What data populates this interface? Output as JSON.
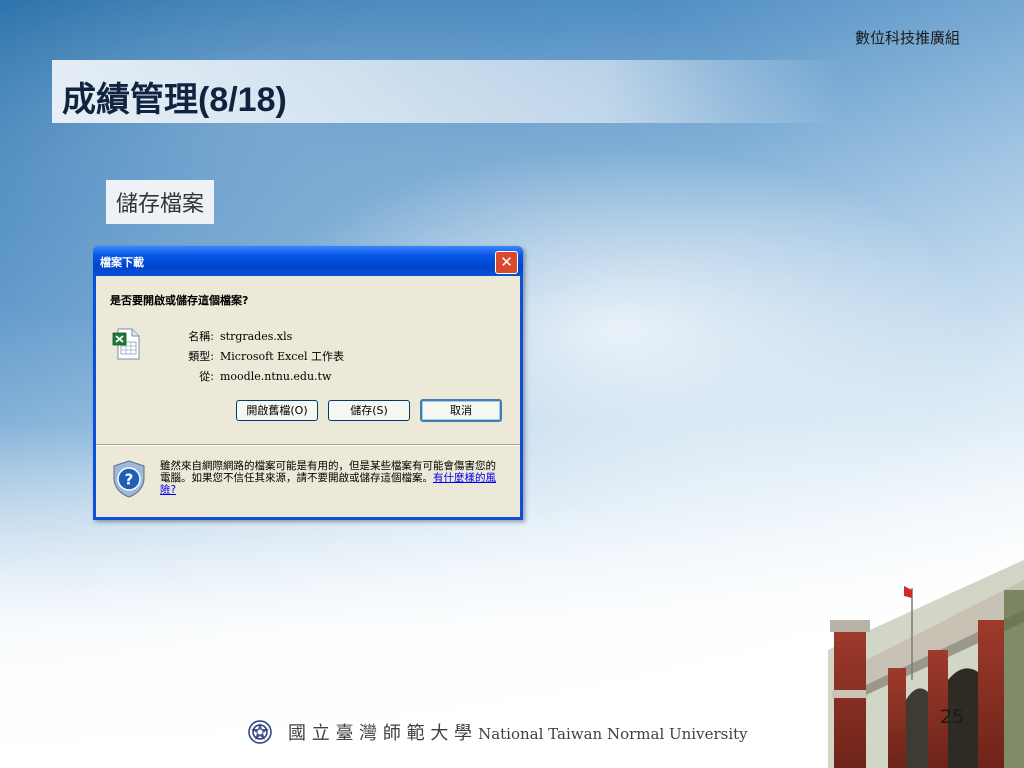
{
  "slide": {
    "department": "數位科技推廣組",
    "title": "成績管理(8/18)",
    "subtitle": "儲存檔案",
    "page_number": "25",
    "footer": {
      "cn": "國 立 臺 灣 師 範 大 學",
      "en": "National Taiwan Normal University"
    }
  },
  "dialog": {
    "title": "檔案下載",
    "close_glyph": "✕",
    "question": "是否要開啟或儲存這個檔案?",
    "file_icon": "excel-file-icon",
    "fields": [
      {
        "label": "名稱:",
        "value": "strgrades.xls"
      },
      {
        "label": "類型:",
        "value": "Microsoft Excel 工作表"
      },
      {
        "label": "從:",
        "value": "moodle.ntnu.edu.tw"
      }
    ],
    "buttons": {
      "open": "開啟舊檔(O)",
      "save": "儲存(S)",
      "cancel": "取消"
    },
    "warning": {
      "icon": "shield-question-icon",
      "text": "雖然來自網際網路的檔案可能是有用的，但是某些檔案有可能會傷害您的電腦。如果您不信任其來源，請不要開啟或儲存這個檔案。",
      "link": "有什麼樣的風險?"
    }
  }
}
